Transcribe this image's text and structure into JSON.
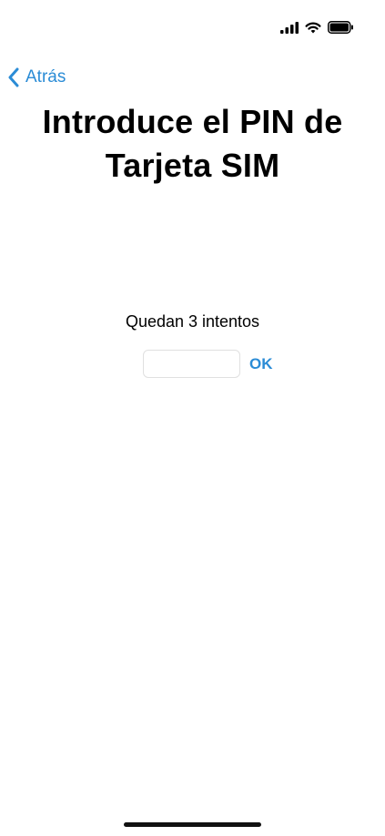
{
  "status_bar": {
    "icons": [
      "signal-icon",
      "wifi-icon",
      "battery-icon"
    ]
  },
  "nav": {
    "back_label": "Atrás",
    "back_icon": "chevron-left-icon"
  },
  "header": {
    "title_line1": "Introduce el PIN de",
    "title_line2": "Tarjeta SIM"
  },
  "pin": {
    "attempts_text": "Quedan 3 intentos",
    "input_value": "",
    "ok_label": "OK"
  },
  "colors": {
    "accent": "#2b8cd6",
    "background": "#ffffff",
    "text": "#000000"
  }
}
